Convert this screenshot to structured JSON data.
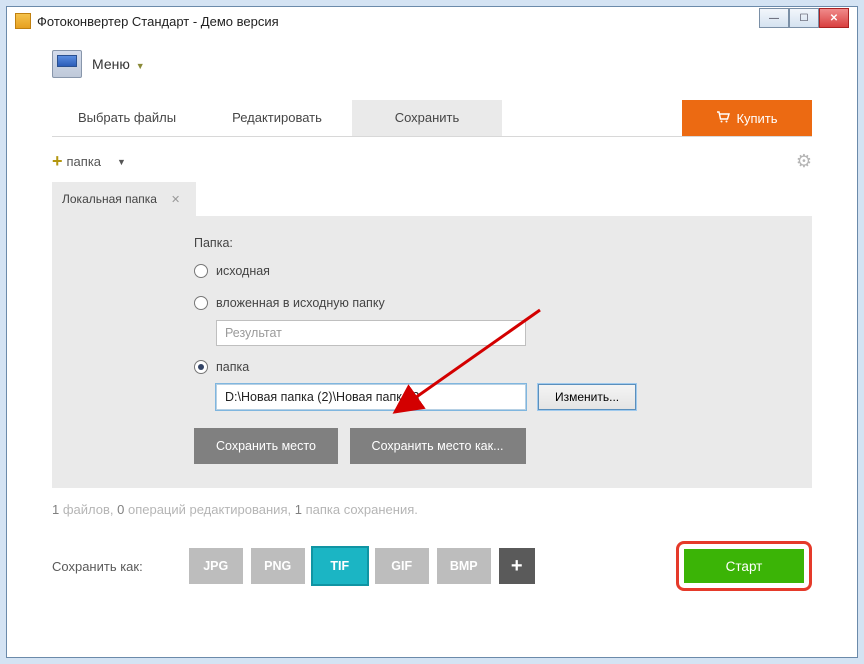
{
  "window": {
    "title": "Фотоконвертер Стандарт - Демо версия"
  },
  "menu": {
    "label": "Меню"
  },
  "tabs": {
    "select": "Выбрать файлы",
    "edit": "Редактировать",
    "save": "Сохранить"
  },
  "buy": {
    "label": "Купить"
  },
  "addFolder": {
    "label": "папка"
  },
  "subTab": {
    "label": "Локальная папка"
  },
  "folder": {
    "heading": "Папка:",
    "r_source": "исходная",
    "r_nested": "вложенная в исходную папку",
    "nested_value": "Результат",
    "r_folder": "папка",
    "path": "D:\\Новая папка (2)\\Новая папка 3",
    "change": "Изменить...",
    "saveLoc": "Сохранить место",
    "saveLocAs": "Сохранить место как..."
  },
  "status": {
    "files_n": "1",
    "files_t": " файлов, ",
    "ops_n": "0",
    "ops_t": " операций редактирования, ",
    "fold_n": "1",
    "fold_t": " папка сохранения."
  },
  "bottom": {
    "label": "Сохранить как:",
    "fmt": {
      "jpg": "JPG",
      "png": "PNG",
      "tif": "TIF",
      "gif": "GIF",
      "bmp": "BMP"
    },
    "start": "Старт"
  }
}
